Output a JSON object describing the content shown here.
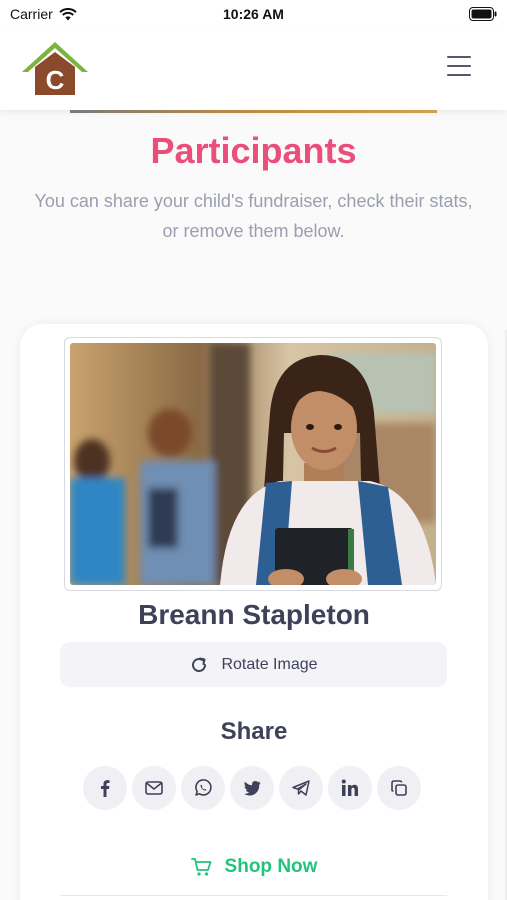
{
  "status_bar": {
    "carrier": "Carrier",
    "time": "10:26 AM"
  },
  "header": {
    "logo_letter": "C",
    "menu_icon": "hamburger-menu-icon"
  },
  "page": {
    "title": "Participants",
    "subtitle": "You can share your child's fundraiser, check their stats, or remove them below."
  },
  "participant": {
    "name": "Breann Stapleton",
    "rotate_label": "Rotate Image"
  },
  "share": {
    "title": "Share",
    "buttons": [
      "facebook-icon",
      "email-icon",
      "whatsapp-icon",
      "twitter-icon",
      "telegram-icon",
      "linkedin-icon",
      "copy-link-icon"
    ]
  },
  "shop": {
    "label": "Shop Now"
  },
  "colors": {
    "title_pink": "#ea4e7b",
    "shop_green": "#22c47b",
    "text_dark": "#3f4159"
  }
}
